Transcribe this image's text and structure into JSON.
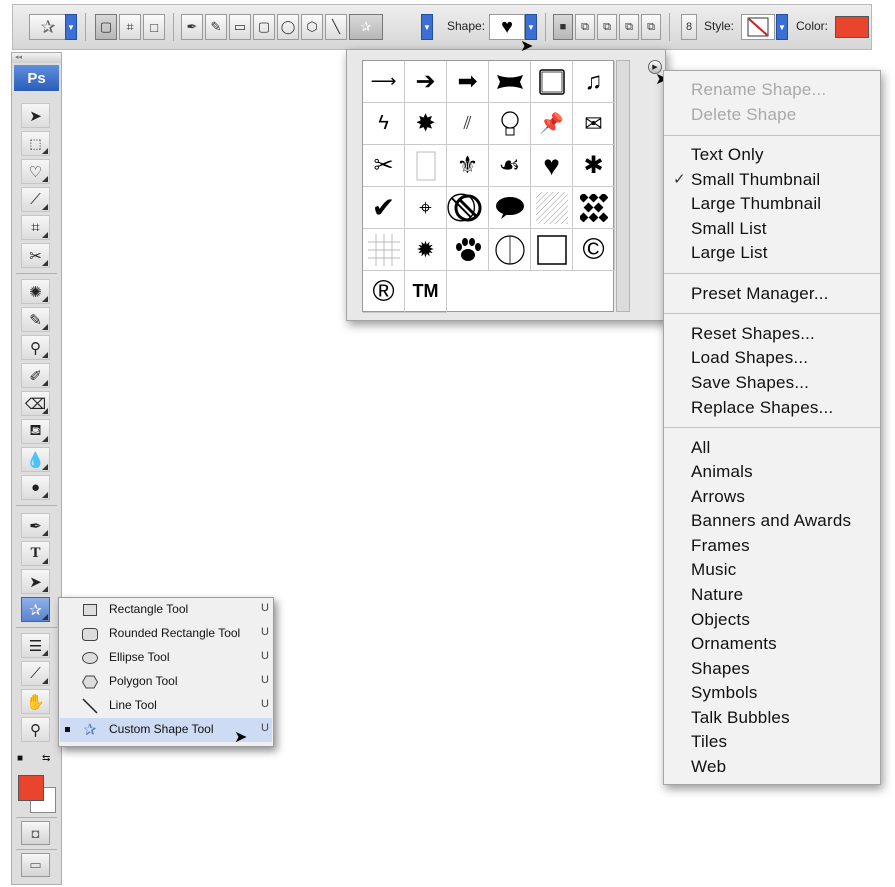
{
  "options_bar": {
    "shape_label": "Shape:",
    "style_label": "Style:",
    "color_label": "Color:",
    "color_value": "#e8452c"
  },
  "toolbox": {
    "logo_text": "Ps",
    "fg_color": "#e8452c",
    "bg_color": "#ffffff"
  },
  "tool_flyout": {
    "items": [
      {
        "label": "Rectangle Tool",
        "key": "U",
        "icon": "rectangle-icon"
      },
      {
        "label": "Rounded Rectangle Tool",
        "key": "U",
        "icon": "rounded-rectangle-icon"
      },
      {
        "label": "Ellipse Tool",
        "key": "U",
        "icon": "ellipse-icon"
      },
      {
        "label": "Polygon Tool",
        "key": "U",
        "icon": "polygon-icon"
      },
      {
        "label": "Line Tool",
        "key": "U",
        "icon": "line-icon"
      },
      {
        "label": "Custom Shape Tool",
        "key": "U",
        "icon": "custom-shape-icon",
        "selected": true
      }
    ]
  },
  "shape_picker": {
    "shapes": [
      "arrow-thin",
      "arrow-medium",
      "arrow-bold",
      "banner",
      "frame",
      "music-note",
      "lightning",
      "starburst",
      "grass",
      "light-bulb",
      "thumbtack",
      "envelope",
      "scissors",
      "blank-page",
      "fleur-de-lis",
      "puzzle-blob",
      "heart",
      "splat",
      "checkmark",
      "target",
      "no-symbol",
      "speech-bubble",
      "diagonal-lines",
      "checkerboard",
      "grid",
      "star-burst-small",
      "paw-print",
      "half-circle",
      "square-frame",
      "copyright",
      "registered",
      "trademark"
    ],
    "trademark_text": "TM"
  },
  "context_menu": {
    "group1": [
      "Rename Shape...",
      "Delete Shape"
    ],
    "group2": [
      "Text Only",
      "Small Thumbnail",
      "Large Thumbnail",
      "Small List",
      "Large List"
    ],
    "group3": [
      "Preset Manager..."
    ],
    "group4": [
      "Reset Shapes...",
      "Load Shapes...",
      "Save Shapes...",
      "Replace Shapes..."
    ],
    "group5": [
      "All",
      "Animals",
      "Arrows",
      "Banners and Awards",
      "Frames",
      "Music",
      "Nature",
      "Objects",
      "Ornaments",
      "Shapes",
      "Symbols",
      "Talk Bubbles",
      "Tiles",
      "Web"
    ],
    "checked_item": "Small Thumbnail"
  }
}
